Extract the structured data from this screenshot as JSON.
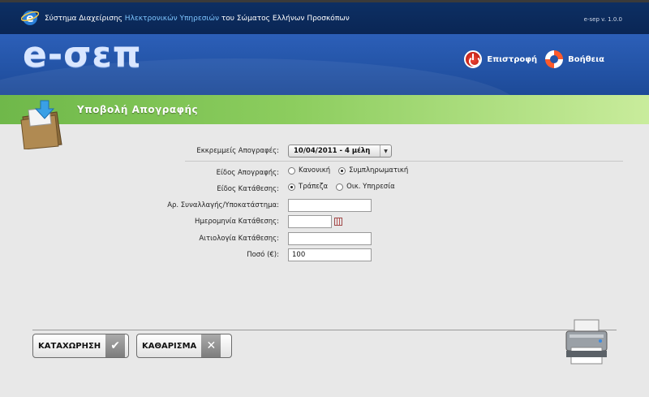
{
  "topbar": {
    "title_pre": "Σύστημα Διαχείρισης ",
    "title_hl": "Ηλεκτρονικών Υπηρεσιών",
    "title_post": " του Σώματος Ελλήνων Προσκόπων",
    "version": "e-sep v. 1.0.0"
  },
  "banner": {
    "brand": "e-σεπ",
    "return_label": "Επιστροφή",
    "help_label": "Βοήθεια"
  },
  "section": {
    "title": "Υποβολή Απογραφής"
  },
  "form": {
    "pending_label": "Εκκρεμμείς Απογραφές:",
    "pending_value": "10/04/2011 - 4 μέλη",
    "type_label": "Είδος Απογραφής:",
    "type_options": [
      "Κανονική",
      "Συμπληρωματική"
    ],
    "deposit_label": "Είδος Κατάθεσης:",
    "deposit_options": [
      "Τράπεζα",
      "Οικ. Υπηρεσία"
    ],
    "transaction_label": "Αρ. Συναλλαγής/Υποκατάστημα:",
    "transaction_value": "",
    "date_label": "Ημερομηνία Κατάθεσης:",
    "date_value": "",
    "reason_label": "Αιτιολογία Κατάθεσης:",
    "reason_value": "",
    "amount_label": "Ποσό (€):",
    "amount_value": "100"
  },
  "buttons": {
    "save_label": "ΚΑΤΑΧΩΡΗΣΗ",
    "clear_label": "ΚΑΘΑΡΙΣΜΑ"
  },
  "colors": {
    "topbar": "#0d2f63",
    "banner": "#2556aa",
    "section_green": "#8ccd5e",
    "title_highlight": "#7ec6ff"
  }
}
